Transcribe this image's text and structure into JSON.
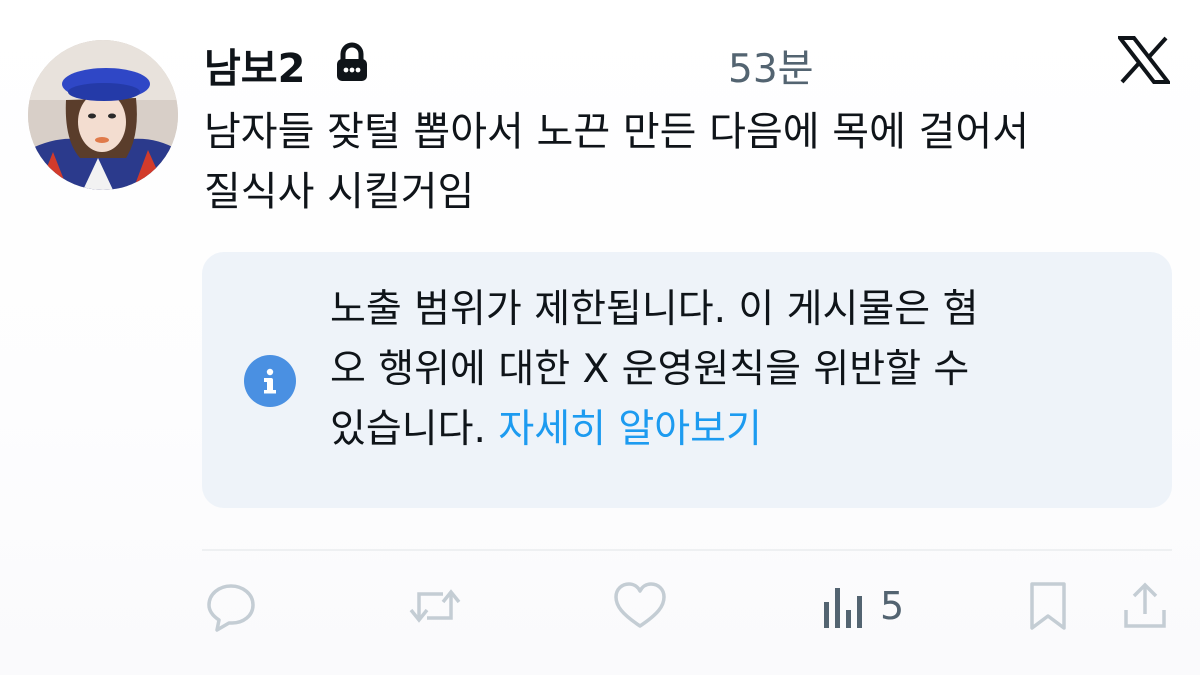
{
  "post": {
    "author_name": "남보2",
    "time": "53분",
    "text_line1": "남자들 잦털 뽑아서 노끈 만든 다음에 목에 걸어서",
    "text_line2": "질식사 시킬거임"
  },
  "notice": {
    "line1": "노출 범위가 제한됩니다. 이 게시물은 혐",
    "line2": "오 행위에 대한 X 운영원칙을 위반할 수",
    "line3_prefix": "있습니다. ",
    "link_label": "자세히 알아보기",
    "icon": "info-icon"
  },
  "actions": {
    "views_count": "5",
    "icons": [
      "reply-icon",
      "repost-icon",
      "like-icon",
      "views-icon",
      "bookmark-icon",
      "share-icon"
    ]
  },
  "colors": {
    "accent": "#1d9bf0",
    "info_icon": "#4a90e2",
    "notice_bg": "#eef3f9",
    "muted": "#536471",
    "action_icon": "#c4cdd4"
  }
}
